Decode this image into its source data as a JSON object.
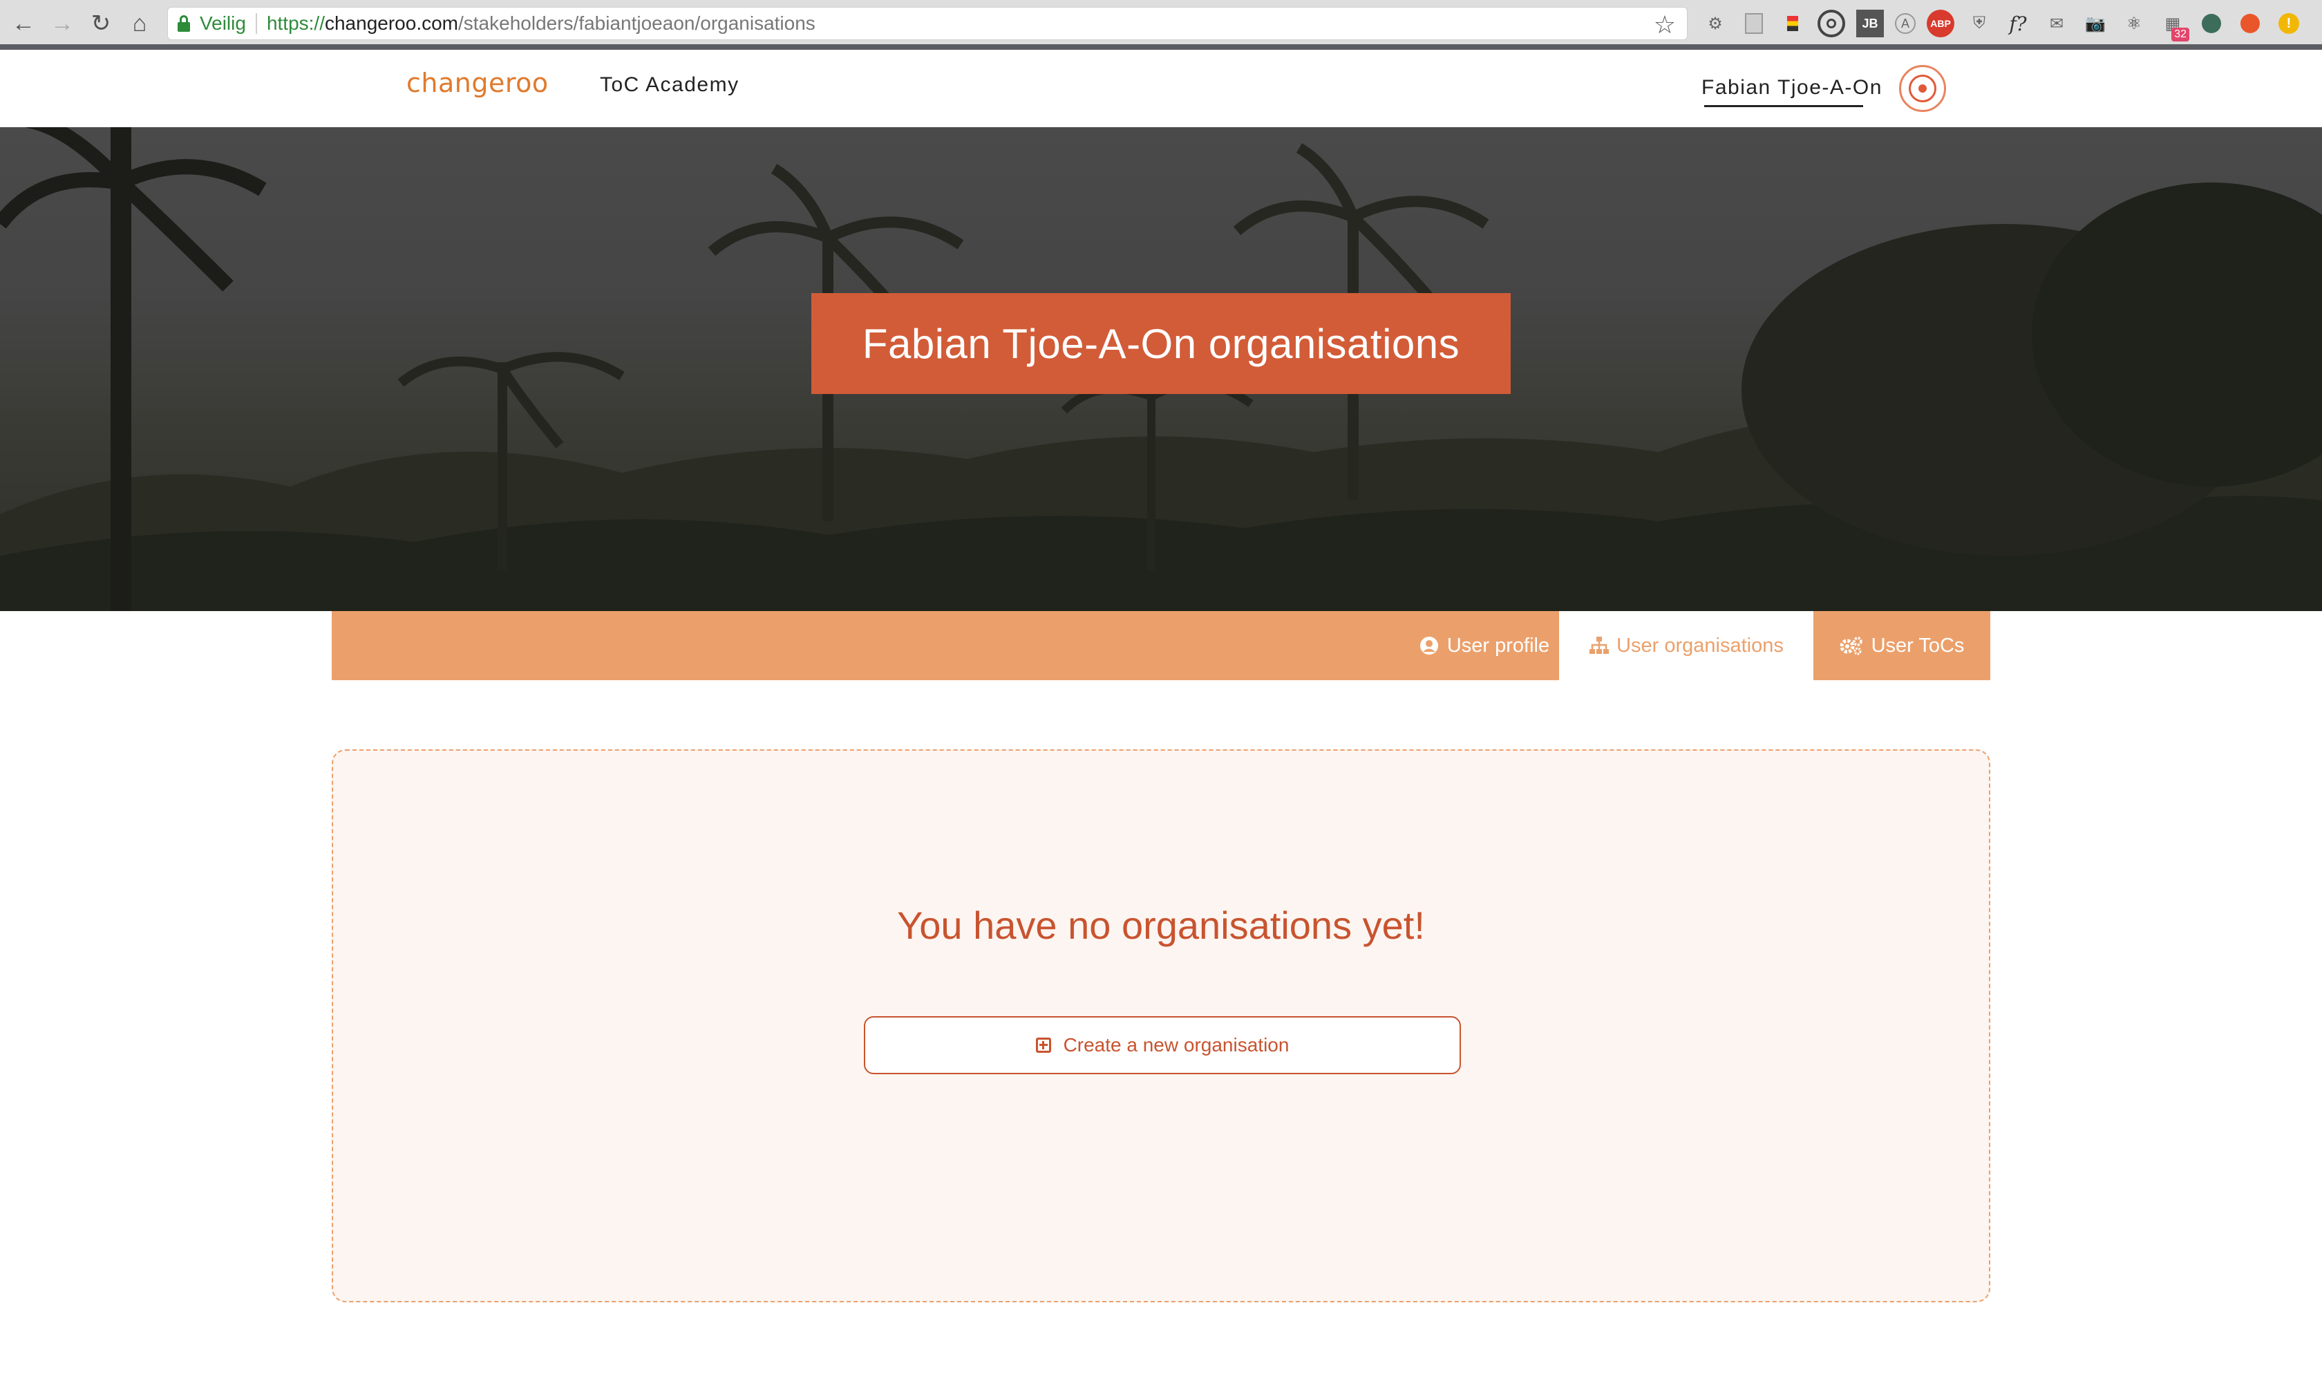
{
  "browser": {
    "secure_label": "Veilig",
    "url_scheme": "https://",
    "url_host": "changeroo.com",
    "url_path": "/stakeholders/fabiantjoeaon/organisations",
    "extensions": [
      "gear-ext-icon",
      "page-ext-icon",
      "flag-ext-icon",
      "target-ext-icon",
      "jb-ext-icon",
      "a-ext-icon",
      "abp-ext-icon",
      "shield-ext-icon",
      "font-ext-icon",
      "mail-ext-icon",
      "camera-ext-icon",
      "react-ext-icon",
      "calendar-ext-icon",
      "circle-ext-icon",
      "fox-ext-icon",
      "alert-ext-icon"
    ],
    "abp_label": "ABP",
    "jb_label": "JB",
    "font_label": "f?",
    "calendar_badge": "32",
    "alert_label": "!"
  },
  "header": {
    "logo": "changeroo",
    "nav_academy": "ToC Academy",
    "user_name": "Fabian Tjoe-A-On"
  },
  "hero": {
    "title": "Fabian Tjoe-A-On organisations"
  },
  "tabs": [
    {
      "label": "User profile",
      "icon": "user-circle-icon",
      "active": false
    },
    {
      "label": "User organisations",
      "icon": "sitemap-icon",
      "active": true
    },
    {
      "label": "User ToCs",
      "icon": "cogs-icon",
      "active": false
    }
  ],
  "empty_state": {
    "message": "You have no organisations yet!",
    "create_label": "Create a new organisation"
  },
  "colors": {
    "brand_orange": "#d25c38",
    "tab_orange": "#eba06b",
    "text_accent": "#c8542f",
    "card_bg": "#fdf5f1"
  }
}
